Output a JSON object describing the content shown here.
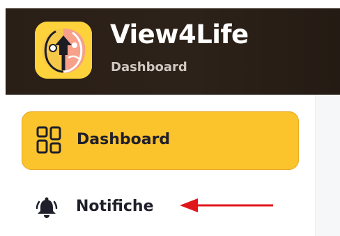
{
  "app": {
    "title": "View4Life",
    "subtitle": "Dashboard"
  },
  "sidebar": {
    "items": [
      {
        "label": "Dashboard",
        "icon": "grid-icon",
        "active": true
      },
      {
        "label": "Notifiche",
        "icon": "bell-icon",
        "active": false
      }
    ]
  },
  "colors": {
    "header_bg": "#2b2018",
    "accent": "#fbc32c",
    "annotation_arrow": "#e0161b"
  }
}
